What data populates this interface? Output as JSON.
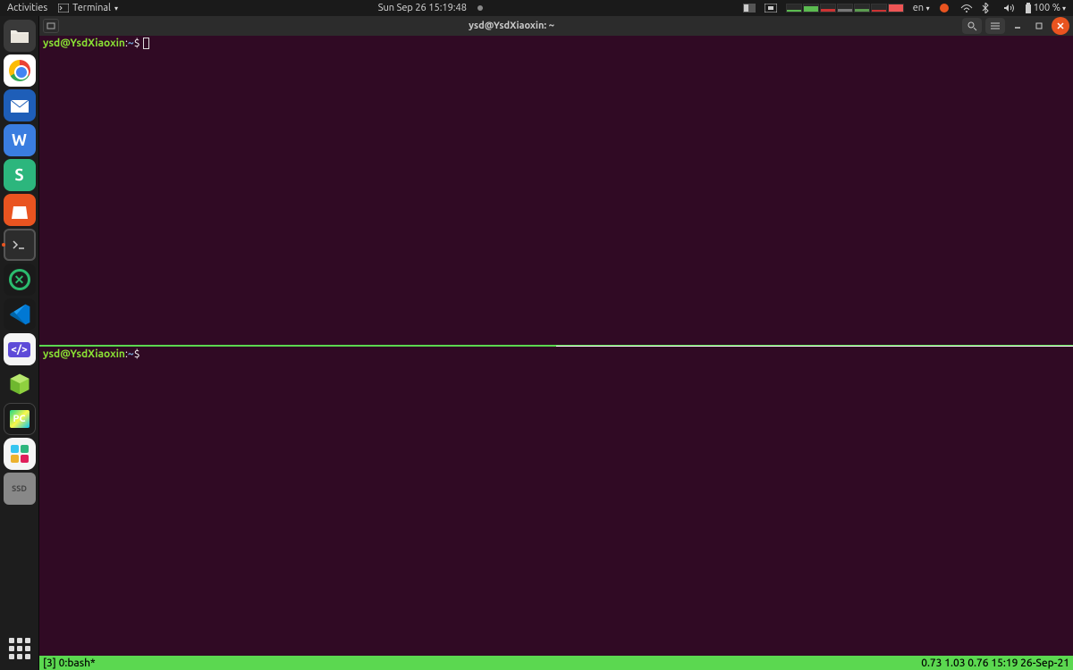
{
  "topbar": {
    "activities": "Activities",
    "app_menu": "Terminal",
    "clock": "Sun Sep 26  15:19:48",
    "lang": "en",
    "battery": "100 %"
  },
  "window": {
    "title": "ysd@YsdXiaoxin: ~"
  },
  "pane1": {
    "user": "ysd@YsdXiaoxin",
    "path": "~",
    "dollar": "$"
  },
  "pane2": {
    "user": "ysd@YsdXiaoxin",
    "path": "~",
    "dollar": "$"
  },
  "tmux": {
    "left": "[3] 0:bash*",
    "right": "0.73 1.03 0.76 15:19 26-Sep-21"
  },
  "dock": {
    "wps": "W",
    "sheets": "S",
    "pycharm": "PC",
    "ssd": "SSD",
    "codealt": "</>"
  }
}
